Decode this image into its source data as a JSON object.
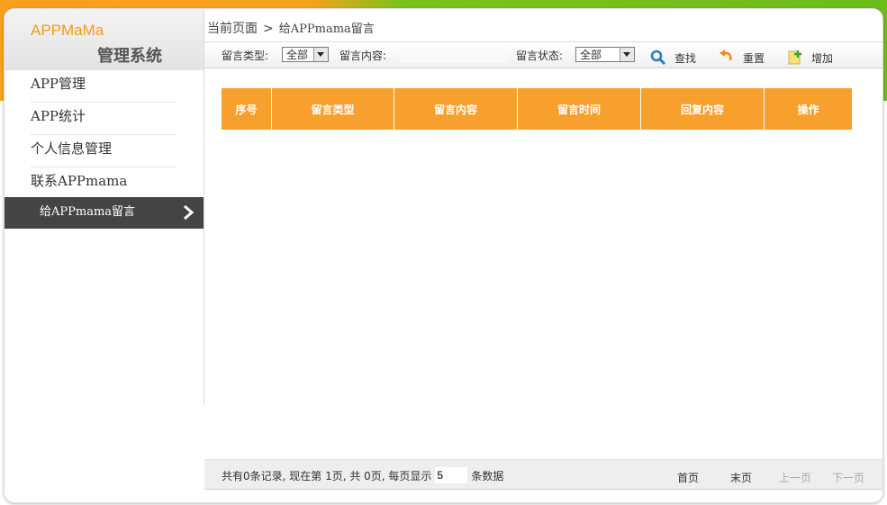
{
  "logo": {
    "en": "APPMaMa",
    "cn": "管理系统"
  },
  "sidebar": {
    "items": [
      {
        "label": "APP管理"
      },
      {
        "label": "APP统计"
      },
      {
        "label": "个人信息管理"
      },
      {
        "label": "联系APPmama"
      }
    ],
    "active_sub": "给APPmama留言"
  },
  "breadcrumb": {
    "root": "当前页面",
    "sep": ">",
    "current": "给APPmama留言"
  },
  "toolbar": {
    "type_label": "留言类型:",
    "type_value": "全部",
    "content_label": "留言内容:",
    "content_value": "",
    "status_label": "留言状态:",
    "status_value": "全部",
    "search": "查找",
    "reset": "重置",
    "add": "增加"
  },
  "table": {
    "columns": [
      "序号",
      "留言类型",
      "留言内容",
      "留言时间",
      "回复内容",
      "操作"
    ],
    "rows": []
  },
  "footer": {
    "summary_prefix": "共有0条记录, 现在第 1页, 共 0页, 每页显示",
    "page_size": "5",
    "summary_suffix": "条数据",
    "first": "首页",
    "last": "末页",
    "prev": "上一页",
    "next": "下一页"
  },
  "colors": {
    "accent": "#f7a02e",
    "brand_orange": "#f39c12",
    "brand_green": "#6cbc1a",
    "submenu_bg": "#444444"
  }
}
